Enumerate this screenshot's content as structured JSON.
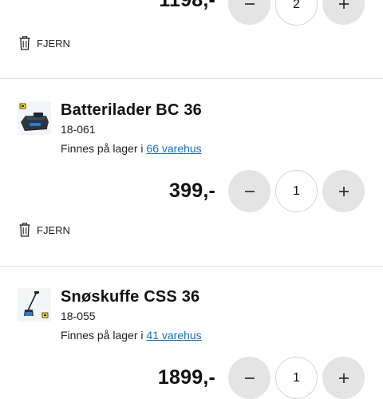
{
  "items": [
    {
      "price": "1198,-",
      "quantity": "2",
      "remove_label": "FJERN"
    },
    {
      "title": "Batterilader BC 36",
      "sku": "18-061",
      "stock_prefix": "Finnes på lager i ",
      "stock_link": "66 varehus",
      "price": "399,-",
      "quantity": "1",
      "remove_label": "FJERN",
      "image_icon": "battery-charger-image"
    },
    {
      "title": "Snøskuffe CSS 36",
      "sku": "18-055",
      "stock_prefix": "Finnes på lager i ",
      "stock_link": "41 varehus",
      "price": "1899,-",
      "quantity": "1",
      "image_icon": "snow-shovel-image"
    }
  ],
  "colors": {
    "link": "#1b6fb6",
    "button_bg": "#e4e4e4",
    "divider": "#dcdcdc"
  }
}
